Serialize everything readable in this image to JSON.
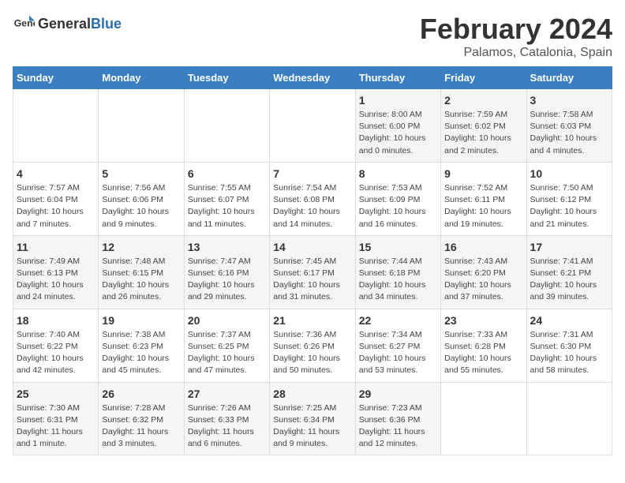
{
  "header": {
    "logo_general": "General",
    "logo_blue": "Blue",
    "title": "February 2024",
    "subtitle": "Palamos, Catalonia, Spain"
  },
  "days_of_week": [
    "Sunday",
    "Monday",
    "Tuesday",
    "Wednesday",
    "Thursday",
    "Friday",
    "Saturday"
  ],
  "weeks": [
    [
      {
        "day": "",
        "info": ""
      },
      {
        "day": "",
        "info": ""
      },
      {
        "day": "",
        "info": ""
      },
      {
        "day": "",
        "info": ""
      },
      {
        "day": "1",
        "info": "Sunrise: 8:00 AM\nSunset: 6:00 PM\nDaylight: 10 hours\nand 0 minutes."
      },
      {
        "day": "2",
        "info": "Sunrise: 7:59 AM\nSunset: 6:02 PM\nDaylight: 10 hours\nand 2 minutes."
      },
      {
        "day": "3",
        "info": "Sunrise: 7:58 AM\nSunset: 6:03 PM\nDaylight: 10 hours\nand 4 minutes."
      }
    ],
    [
      {
        "day": "4",
        "info": "Sunrise: 7:57 AM\nSunset: 6:04 PM\nDaylight: 10 hours\nand 7 minutes."
      },
      {
        "day": "5",
        "info": "Sunrise: 7:56 AM\nSunset: 6:06 PM\nDaylight: 10 hours\nand 9 minutes."
      },
      {
        "day": "6",
        "info": "Sunrise: 7:55 AM\nSunset: 6:07 PM\nDaylight: 10 hours\nand 11 minutes."
      },
      {
        "day": "7",
        "info": "Sunrise: 7:54 AM\nSunset: 6:08 PM\nDaylight: 10 hours\nand 14 minutes."
      },
      {
        "day": "8",
        "info": "Sunrise: 7:53 AM\nSunset: 6:09 PM\nDaylight: 10 hours\nand 16 minutes."
      },
      {
        "day": "9",
        "info": "Sunrise: 7:52 AM\nSunset: 6:11 PM\nDaylight: 10 hours\nand 19 minutes."
      },
      {
        "day": "10",
        "info": "Sunrise: 7:50 AM\nSunset: 6:12 PM\nDaylight: 10 hours\nand 21 minutes."
      }
    ],
    [
      {
        "day": "11",
        "info": "Sunrise: 7:49 AM\nSunset: 6:13 PM\nDaylight: 10 hours\nand 24 minutes."
      },
      {
        "day": "12",
        "info": "Sunrise: 7:48 AM\nSunset: 6:15 PM\nDaylight: 10 hours\nand 26 minutes."
      },
      {
        "day": "13",
        "info": "Sunrise: 7:47 AM\nSunset: 6:16 PM\nDaylight: 10 hours\nand 29 minutes."
      },
      {
        "day": "14",
        "info": "Sunrise: 7:45 AM\nSunset: 6:17 PM\nDaylight: 10 hours\nand 31 minutes."
      },
      {
        "day": "15",
        "info": "Sunrise: 7:44 AM\nSunset: 6:18 PM\nDaylight: 10 hours\nand 34 minutes."
      },
      {
        "day": "16",
        "info": "Sunrise: 7:43 AM\nSunset: 6:20 PM\nDaylight: 10 hours\nand 37 minutes."
      },
      {
        "day": "17",
        "info": "Sunrise: 7:41 AM\nSunset: 6:21 PM\nDaylight: 10 hours\nand 39 minutes."
      }
    ],
    [
      {
        "day": "18",
        "info": "Sunrise: 7:40 AM\nSunset: 6:22 PM\nDaylight: 10 hours\nand 42 minutes."
      },
      {
        "day": "19",
        "info": "Sunrise: 7:38 AM\nSunset: 6:23 PM\nDaylight: 10 hours\nand 45 minutes."
      },
      {
        "day": "20",
        "info": "Sunrise: 7:37 AM\nSunset: 6:25 PM\nDaylight: 10 hours\nand 47 minutes."
      },
      {
        "day": "21",
        "info": "Sunrise: 7:36 AM\nSunset: 6:26 PM\nDaylight: 10 hours\nand 50 minutes."
      },
      {
        "day": "22",
        "info": "Sunrise: 7:34 AM\nSunset: 6:27 PM\nDaylight: 10 hours\nand 53 minutes."
      },
      {
        "day": "23",
        "info": "Sunrise: 7:33 AM\nSunset: 6:28 PM\nDaylight: 10 hours\nand 55 minutes."
      },
      {
        "day": "24",
        "info": "Sunrise: 7:31 AM\nSunset: 6:30 PM\nDaylight: 10 hours\nand 58 minutes."
      }
    ],
    [
      {
        "day": "25",
        "info": "Sunrise: 7:30 AM\nSunset: 6:31 PM\nDaylight: 11 hours\nand 1 minute."
      },
      {
        "day": "26",
        "info": "Sunrise: 7:28 AM\nSunset: 6:32 PM\nDaylight: 11 hours\nand 3 minutes."
      },
      {
        "day": "27",
        "info": "Sunrise: 7:26 AM\nSunset: 6:33 PM\nDaylight: 11 hours\nand 6 minutes."
      },
      {
        "day": "28",
        "info": "Sunrise: 7:25 AM\nSunset: 6:34 PM\nDaylight: 11 hours\nand 9 minutes."
      },
      {
        "day": "29",
        "info": "Sunrise: 7:23 AM\nSunset: 6:36 PM\nDaylight: 11 hours\nand 12 minutes."
      },
      {
        "day": "",
        "info": ""
      },
      {
        "day": "",
        "info": ""
      }
    ]
  ]
}
